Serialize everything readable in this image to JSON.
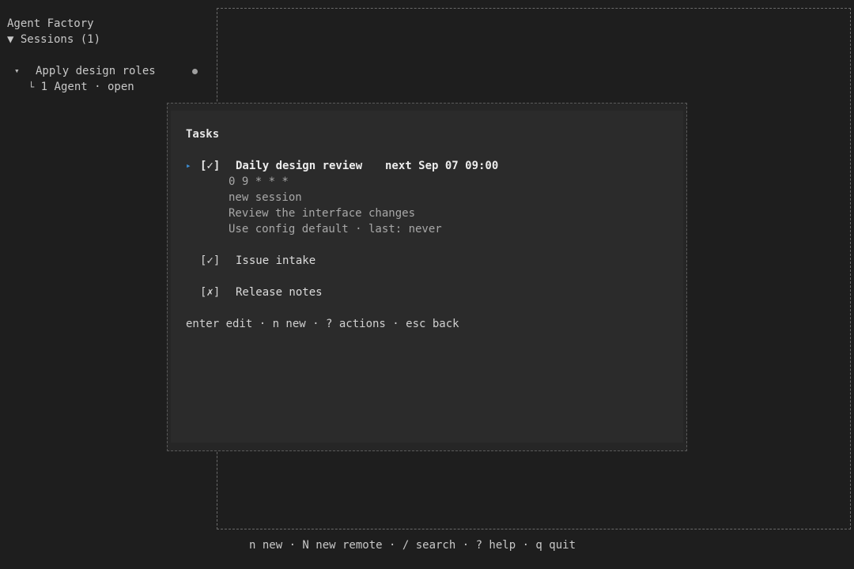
{
  "sidebar": {
    "app_title": "Agent Factory",
    "sessions_header": "▼ Sessions (1)",
    "session": {
      "caret": "▾",
      "title": "Apply design roles",
      "branch_glyph": "└",
      "subtitle": "1 Agent · open"
    }
  },
  "status_bar": {
    "hints": "n new · N new remote · / search · ? help · q quit"
  },
  "modal": {
    "title": "Tasks",
    "tasks": [
      {
        "pointer": "▸",
        "check": "[✓]",
        "name": "Daily design review",
        "next": "next Sep 07 09:00",
        "details": [
          "0 9 * * *",
          "new session",
          "Review the interface changes",
          "Use config default · last: never"
        ]
      },
      {
        "check": "[✓]",
        "name": "Issue intake"
      },
      {
        "check": "[✗]",
        "name": "Release notes"
      }
    ],
    "hints": "enter edit · n new · ? actions · esc back"
  },
  "colors": {
    "background": "#1e1e1e",
    "modal_background": "#2b2b2b",
    "accent_pointer": "#3d8fd6",
    "text": "#c8c8c8"
  }
}
